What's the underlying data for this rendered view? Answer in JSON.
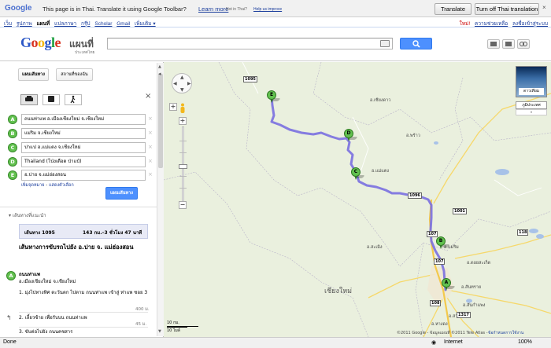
{
  "translate_bar": {
    "logo": "Google",
    "message": "This page is in Thai.  Translate it using Google Toolbar?",
    "learn_more": "Learn more",
    "not_in_thai": "Not in Thai?",
    "help_improve": "Help us improve",
    "translate_button": "Translate",
    "turn_off_button": "Turn off Thai translation",
    "close": "×"
  },
  "google_bar": {
    "nav": [
      "เว็บ",
      "รูปภาพ",
      "แผนที่",
      "แปลภาษา",
      "กรุ๊ป",
      "Scholar",
      "Gmail",
      "เพิ่มเติม ▾"
    ],
    "current": "แผนที่",
    "new_label": "ใหม่!",
    "help": "ความช่วยเหลือ",
    "signin": "ลงชื่อเข้าสู่ระบบ"
  },
  "header": {
    "logo_letters": [
      "G",
      "o",
      "o",
      "g",
      "l",
      "e"
    ],
    "product": "แผนที่",
    "region": "ประเทศไทย",
    "search_value": ""
  },
  "left": {
    "tab_directions": "แผนเส้นทาง",
    "tab_mymaps": "สถานที่ของฉัน",
    "modes": [
      "car-icon",
      "transit-icon",
      "walk-icon"
    ],
    "waypoints": [
      {
        "letter": "A",
        "value": "ถนนท่าแพ อ.เมืองเชียงใหม่ จ.เชียงใหม่"
      },
      {
        "letter": "B",
        "value": "แม่ริม จ.เชียงใหม่"
      },
      {
        "letter": "C",
        "value": "ปาแป อ.แม่แตง จ.เชียงใหม่"
      },
      {
        "letter": "D",
        "value": "Thailand (โป่งเดือด ป่าแป๋)"
      },
      {
        "letter": "E",
        "value": "อ.ปาย จ.แม่ฮ่องสอน"
      }
    ],
    "add_destination": "เพิ่มจุดหมาย",
    "show_options": "แสดงตัวเลือก",
    "get_directions": "แผนเส้นทาง",
    "suggested_routes": "เส้นทางที่แนะนำ",
    "route_name": "เส้นทาง 1095",
    "route_detail": "143 กม.–3 ชั่วโมง 47 นาที",
    "title": "เส้นทางการขับรถไปยัง อ.ปาย จ. แม่ฮ่องสอน",
    "start_letter": "A",
    "start_name": "ถนนท่าแพ",
    "start_sub": "อ.เมืองเชียงใหม่ จ.เชียงใหม่",
    "steps": [
      {
        "text": "1. มุ่งไปทางทิศ ตะวันตก ไปตาม ถนนท่าแพ เข้าสู่ ท่าแพ ซอย 3",
        "dist": "400 ม."
      },
      {
        "text": "2. เลี้ยวซ้าย เพื่อรับบน ถนนท่าแพ",
        "dist": "45 ม."
      },
      {
        "text": "3. ขับต่อไปยัง ถนนคชสาร",
        "dist": ""
      }
    ]
  },
  "map": {
    "route_color": "#7a6fe0",
    "pins": [
      "A",
      "B",
      "C",
      "D",
      "E"
    ],
    "place_labels": [
      "อ.แม่แตง",
      "อ.สะเมิง",
      "อ.แม่ริม",
      "อ.ดอยสะเก็ด",
      "อ.สันทราย",
      "อ.หางดง",
      "อ.สันกำแพง",
      "อ.สารภี",
      "อ.เวียงแหง",
      "อ.ปาย",
      "อ.เชียงดาว",
      "อ.พร้าว"
    ],
    "city_label": "เชียงใหม่",
    "route_numbers": [
      "1095",
      "107",
      "118",
      "1096",
      "1001",
      "108",
      "1317",
      "107"
    ],
    "satellite": "ดาวเทียม",
    "terrain": "ภูมิประเทศ",
    "scale_km": "10 กม.",
    "scale_mi": "10 ไมล์",
    "copyright": "©2011 Google - ข้อมูลแผนที่ ©2011 Tele Atlas -",
    "report": "ข้อกำหนดการใช้งาน"
  },
  "status": {
    "left": "Done",
    "zone": "Internet",
    "zoom": "100%"
  }
}
